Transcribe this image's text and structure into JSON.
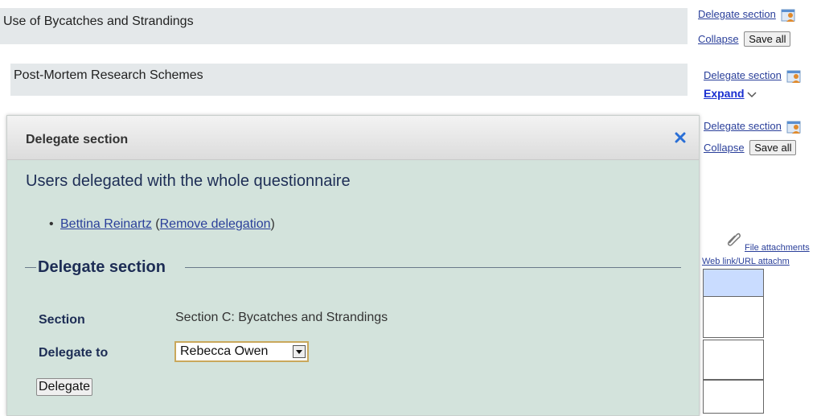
{
  "sections": [
    {
      "title": "Use of Bycatches and Strandings",
      "delegate_label": "Delegate section",
      "toggle_label": "Collapse",
      "save_label": "Save all"
    },
    {
      "title": "Post-Mortem Research Schemes",
      "delegate_label": "Delegate section",
      "toggle_label": "Expand",
      "toggle_icon": "chevron-down-icon"
    },
    {
      "delegate_label": "Delegate section",
      "toggle_label": "Collapse",
      "save_label": "Save all"
    }
  ],
  "attachments": {
    "file_label": "File attachments",
    "weblink_label": "Web link/URL attachm"
  },
  "modal": {
    "title": "Delegate section",
    "close_icon": "close-icon",
    "heading": "Users delegated with the whole questionnaire",
    "delegated_user": "Bettina Reinartz",
    "remove_open": "(",
    "remove_label": "Remove delegation",
    "remove_close": ")",
    "fieldset_legend": "Delegate section",
    "section_label": "Section",
    "section_value": "Section C: Bycatches and Strandings",
    "delegate_to_label": "Delegate to",
    "delegate_to_value": "Rebecca Owen",
    "submit_label": "Delegate"
  },
  "colors": {
    "section_bar": "#e4e8ea",
    "modal_body": "#d3e3dc",
    "link": "#2a3f9a",
    "close": "#2a6fd6",
    "highlight_cell": "#c9dcff"
  }
}
